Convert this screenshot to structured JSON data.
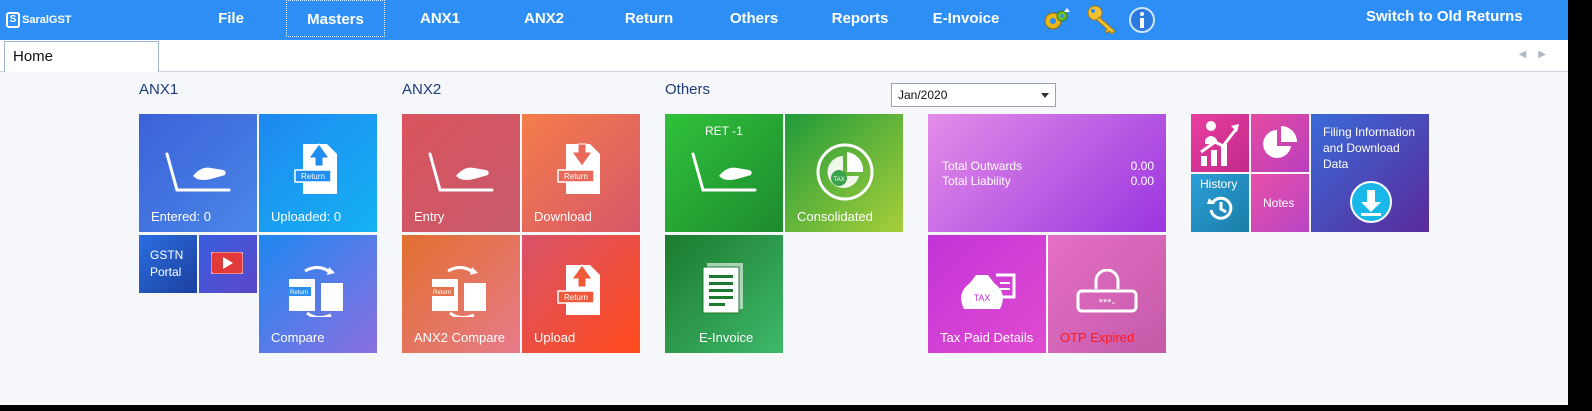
{
  "app": {
    "logo_text": "SaralGST"
  },
  "menu": [
    {
      "label": "File"
    },
    {
      "label": "Masters"
    },
    {
      "label": "ANX1"
    },
    {
      "label": "ANX2"
    },
    {
      "label": "Return"
    },
    {
      "label": "Others"
    },
    {
      "label": "Reports"
    },
    {
      "label": "E-Invoice"
    }
  ],
  "toolbar_icons": [
    "settings-gear-icon",
    "key-icon",
    "info-icon"
  ],
  "switch_label": "Switch to Old Returns",
  "tabs": [
    {
      "label": "Home"
    }
  ],
  "sections": {
    "anx1": "ANX1",
    "anx2": "ANX2",
    "others": "Others"
  },
  "period": {
    "selected": "Jan/2020"
  },
  "tiles": {
    "anx1_entered": "Entered: 0",
    "anx1_uploaded": "Uploaded: 0",
    "gstn_portal": "GSTN Portal",
    "anx1_compare": "Compare",
    "anx2_entry": "Entry",
    "anx2_download": "Download",
    "anx2_compare": "ANX2 Compare",
    "anx2_upload": "Upload",
    "ret1": "RET -1",
    "consolidated": "Consolidated",
    "einvoice": "E-Invoice",
    "tax_paid": "Tax Paid Details",
    "otp": "OTP Expired",
    "history": "History",
    "notes": "Notes",
    "filing_info": "Filing Information and Download Data"
  },
  "summary": {
    "total_outwards_label": "Total Outwards",
    "total_outwards_value": "0.00",
    "total_liability_label": "Total Liability",
    "total_liability_value": "0.00"
  },
  "colors": {
    "topbar": "#2d8ff5",
    "otp_expired_text": "#ff1a1a"
  }
}
